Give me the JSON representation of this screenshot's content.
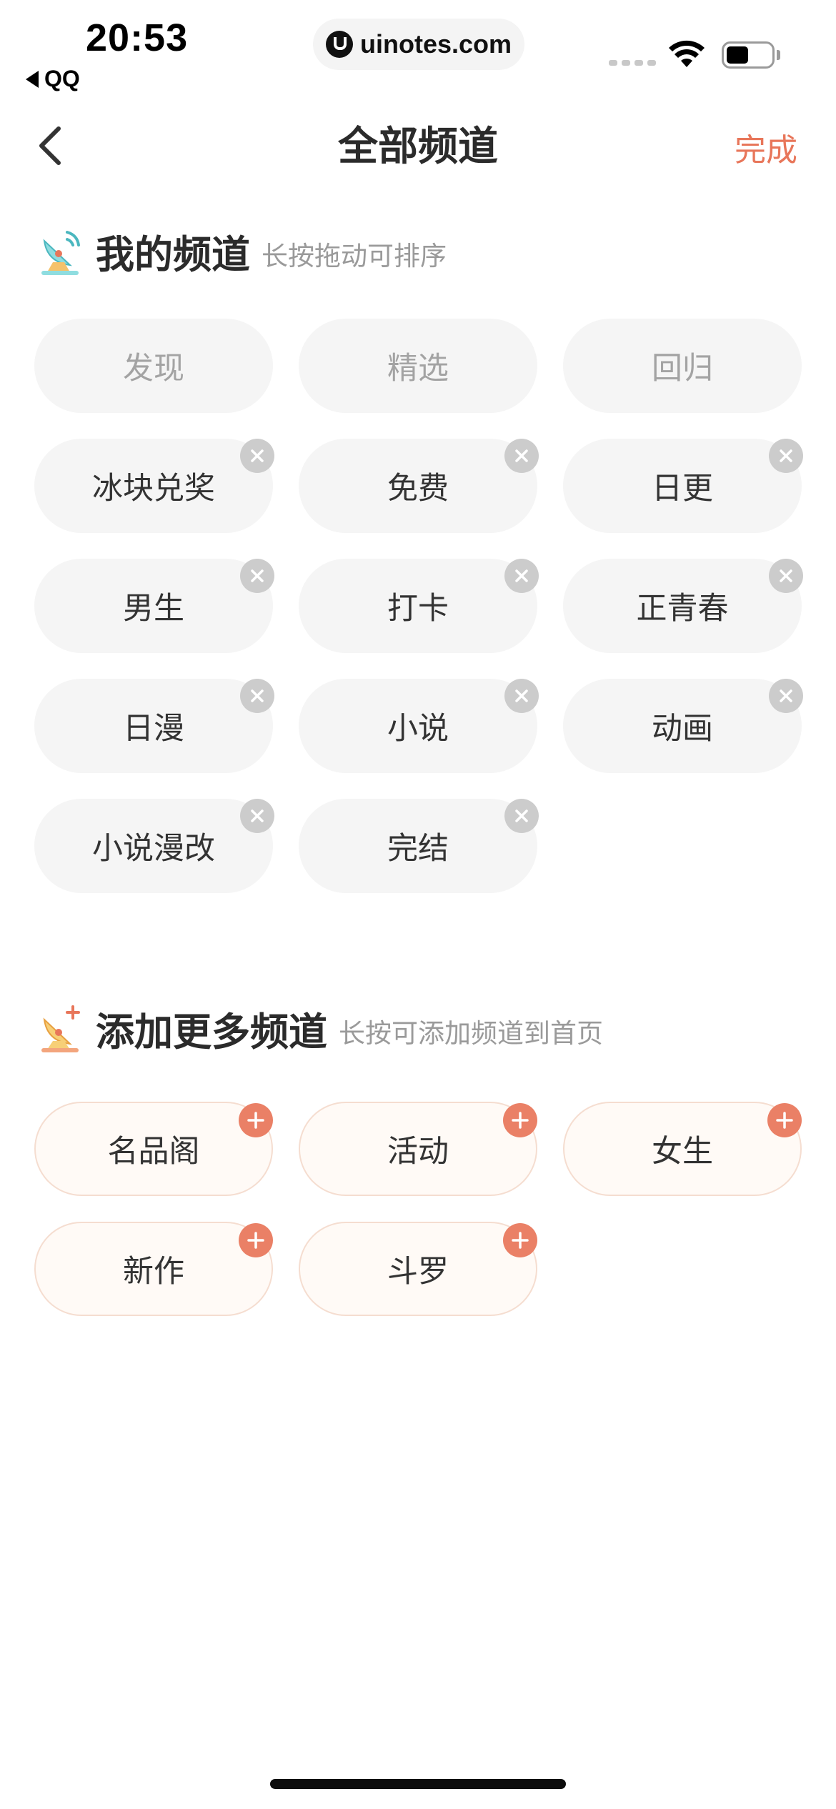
{
  "status_bar": {
    "time": "20:53",
    "back_app": "QQ",
    "url": "uinotes.com"
  },
  "nav": {
    "title": "全部频道",
    "done": "完成"
  },
  "my_channels": {
    "title": "我的频道",
    "hint": "长按拖动可排序",
    "fixed": [
      "发现",
      "精选",
      "回归"
    ],
    "items": [
      "冰块兑奖",
      "免费",
      "日更",
      "男生",
      "打卡",
      "正青春",
      "日漫",
      "小说",
      "动画",
      "小说漫改",
      "完结"
    ]
  },
  "more_channels": {
    "title": "添加更多频道",
    "hint": "长按可添加频道到首页",
    "items": [
      "名品阁",
      "活动",
      "女生",
      "新作",
      "斗罗"
    ]
  },
  "colors": {
    "accent": "#e8765a",
    "plus_badge": "#ea8066",
    "remove_badge": "#cccccc",
    "chip_bg": "#f5f5f5",
    "add_chip_bg": "#fffaf6"
  },
  "icons": {
    "nav_back": "chevron-left-icon",
    "my_channels": "satellite-dish-icon",
    "more_channels": "satellite-dish-sparkle-icon",
    "remove": "close-icon",
    "add": "plus-icon"
  }
}
